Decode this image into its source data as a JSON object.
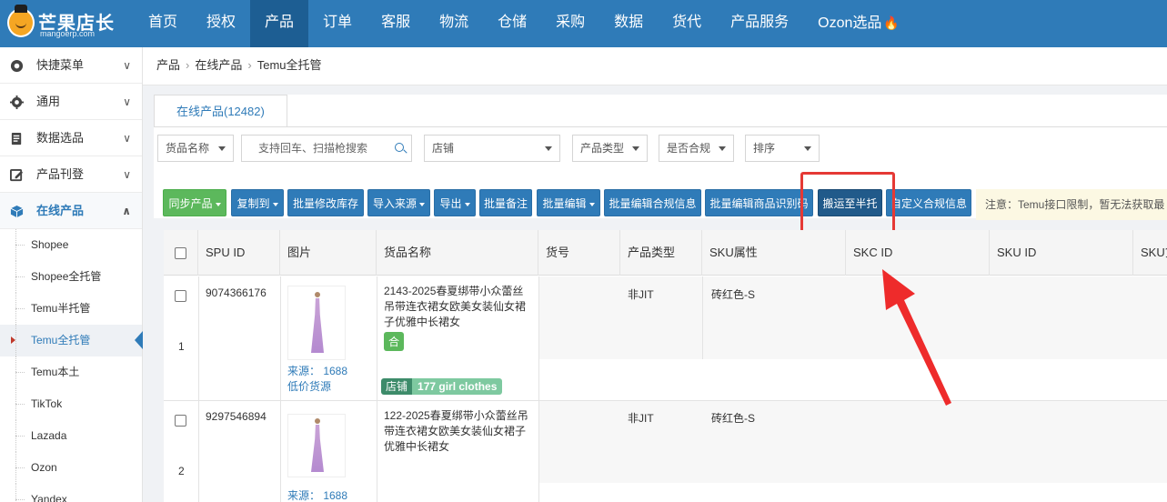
{
  "brand": {
    "title": "芒果店长",
    "domain": "mangoerp.com"
  },
  "nav": [
    "首页",
    "授权",
    "产品",
    "订单",
    "客服",
    "物流",
    "仓储",
    "采购",
    "数据",
    "货代",
    "产品服务",
    "Ozon选品"
  ],
  "nav_active": "产品",
  "sidebar": {
    "groups": [
      {
        "label": "快捷菜单",
        "icon": "dashboard-icon"
      },
      {
        "label": "通用",
        "icon": "gear-icon"
      },
      {
        "label": "数据选品",
        "icon": "database-icon"
      },
      {
        "label": "产品刊登",
        "icon": "edit-icon"
      },
      {
        "label": "在线产品",
        "icon": "cube-icon"
      }
    ],
    "subitems": [
      "Shopee",
      "Shopee全托管",
      "Temu半托管",
      "Temu全托管",
      "Temu本土",
      "TikTok",
      "Lazada",
      "Ozon",
      "Yandex"
    ],
    "active_sub": "Temu全托管"
  },
  "breadcrumb": [
    "产品",
    "在线产品",
    "Temu全托管"
  ],
  "tab": "在线产品(12482)",
  "filters": {
    "name_select": "货品名称",
    "search_placeholder": "支持回车、扫描枪搜索",
    "store": "店铺",
    "product_type": "产品类型",
    "compliance": "是否合规",
    "sort": "排序"
  },
  "toolbar": {
    "sync": "同步产品",
    "copy": "复制到",
    "batch_stock": "批量修改库存",
    "import_source": "导入来源",
    "export": "导出",
    "batch_note": "批量备注",
    "batch_edit": "批量编辑",
    "batch_compliance": "批量编辑合规信息",
    "batch_code": "批量编辑商品识别码",
    "move_half": "搬运至半托",
    "custom_compliance": "自定义合规信息",
    "notice": "注意：Temu接口限制，暂无法获取最"
  },
  "table": {
    "headers": [
      "SPU ID",
      "图片",
      "货品名称",
      "货号",
      "产品类型",
      "SKU属性",
      "SKC ID",
      "SKU ID",
      "SKU货"
    ],
    "rows": [
      {
        "index": "1",
        "spu_id": "9074366176",
        "source": "来源： 1688",
        "source_extra": "低价货源",
        "name": "2143-2025春夏绑带小众蕾丝吊带连衣裙女欧美女装仙女裙子优雅中长裙女",
        "compliance_badge": "合",
        "type": "非JIT",
        "sku_attr": "砖红色-S",
        "store_label": "店铺",
        "store_name": "177 girl clothes"
      },
      {
        "index": "2",
        "spu_id": "9297546894",
        "source": "来源： 1688",
        "name": "122-2025春夏绑带小众蕾丝吊带连衣裙女欧美女装仙女裙子优雅中长裙女",
        "type": "非JIT",
        "sku_attr": "砖红色-S"
      }
    ]
  },
  "colors": {
    "primary": "#2f7bb8",
    "green": "#5cb85c",
    "highlight": "#e53935"
  }
}
